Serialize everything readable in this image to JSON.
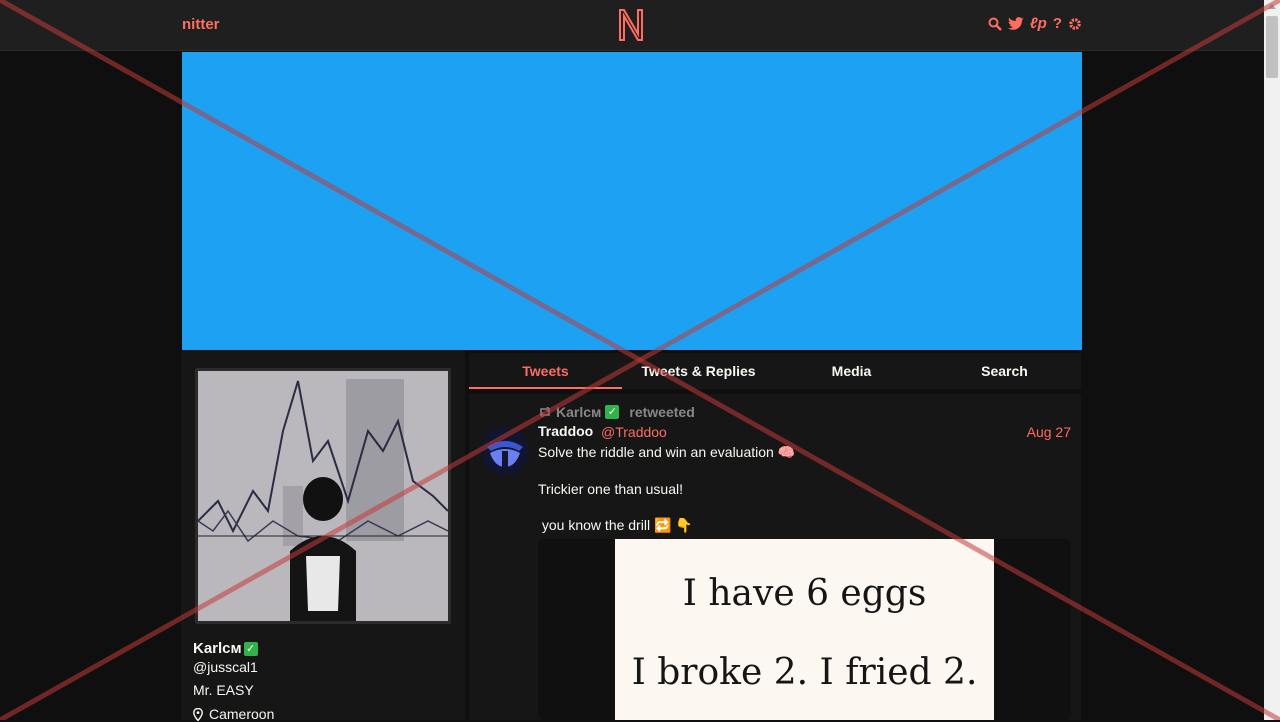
{
  "nav": {
    "brand": "nitter",
    "logo_letter": "N",
    "icons": [
      "search-icon",
      "twitter-bird-icon",
      "rss-icon",
      "help-icon",
      "gear-icon"
    ],
    "accent": "#ff6c60"
  },
  "banner": {
    "color": "#1da1f2"
  },
  "profile": {
    "fullname": "Karlᴄᴍ",
    "verified_mark": "✓",
    "username": "@jusscal1",
    "bio": "Mr. EASY",
    "location": "Cameroon"
  },
  "tabs": [
    {
      "label": "Tweets",
      "active": true
    },
    {
      "label": "Tweets & Replies"
    },
    {
      "label": "Media"
    },
    {
      "label": "Search"
    }
  ],
  "tweet": {
    "retweeter": "Karlᴄᴍ",
    "retweet_text": "retweeted",
    "author_name": "Traddoo",
    "author_handle": "@Traddoo",
    "date": "Aug 27",
    "lines": [
      "Solve the riddle and win an evaluation 🧠",
      "Trickier one than usual!",
      " you know the drill 🔁 👇"
    ],
    "attachment_text": [
      "I have 6 eggs",
      "I broke 2. I fried 2."
    ]
  }
}
